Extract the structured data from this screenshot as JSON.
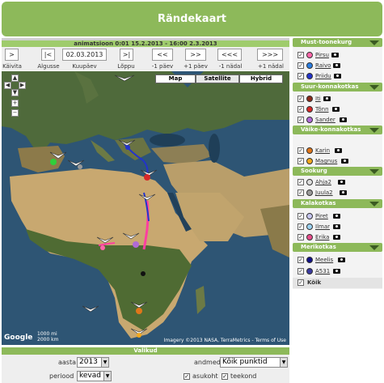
{
  "title": "Rändekaart",
  "animation": {
    "header": "animatsioon 0:01 15.2.2013 - 16:00 2.3.2013",
    "date_value": "02.03.2013",
    "buttons": [
      {
        "symbol": ">",
        "label": "Käivita"
      },
      {
        "symbol": "|<",
        "label": "Algusse"
      },
      {
        "symbol": ">|",
        "label": "Lõppu"
      },
      {
        "symbol": "<<",
        "label": "-1 päev"
      },
      {
        "symbol": ">>",
        "label": "+1 päev"
      },
      {
        "symbol": "<<<",
        "label": "-1 nädal"
      },
      {
        "symbol": ">>>",
        "label": "+1 nädal"
      }
    ],
    "date_label": "Kuupäev"
  },
  "map": {
    "types": [
      "Map",
      "Satellite",
      "Hybrid"
    ],
    "active_type": "Satellite",
    "copyright": "Imagery ©2013 NASA, TerraMetrics - Terms of Use",
    "logo": "Google",
    "scale": [
      "1000 mi",
      "2000 km"
    ]
  },
  "options": {
    "header": "Valikud",
    "year_label": "aasta",
    "year_value": "2013",
    "period_label": "periood",
    "period_value": "kevad",
    "data_label": "andmed",
    "data_value": "Kõik punktid",
    "location_label": "asukoht",
    "route_label": "teekond"
  },
  "groups": [
    {
      "name": "Must-toonekurg",
      "birds": [
        {
          "name": "Pirsu",
          "color": "#ff66aa",
          "checked": true
        },
        {
          "name": "Raivo",
          "color": "#2a7de1",
          "checked": true
        },
        {
          "name": "Priidu",
          "color": "#2233cc",
          "checked": true
        }
      ]
    },
    {
      "name": "Suur-konnakotkas",
      "birds": [
        {
          "name": "Iti",
          "color": "#8b2a1a",
          "checked": true
        },
        {
          "name": "Tõnn",
          "color": "#d62828",
          "checked": true
        },
        {
          "name": "Sander",
          "color": "#b06ad6",
          "checked": true
        }
      ]
    },
    {
      "name": "Väike-konnakotkas",
      "birds": [
        {
          "name": "Karin",
          "color": "#e0761a",
          "checked": true
        },
        {
          "name": "Magnus",
          "color": "#f2a81d",
          "checked": true
        }
      ]
    },
    {
      "name": "Sookurg",
      "birds": [
        {
          "name": "Ahja2",
          "color": "#dddddd",
          "checked": true
        },
        {
          "name": "Juula2",
          "color": "#9a9a9a",
          "checked": true
        }
      ]
    },
    {
      "name": "Kalakotkas",
      "birds": [
        {
          "name": "Piret",
          "color": "#c6c6f0",
          "checked": true
        },
        {
          "name": "Ilmar",
          "color": "#9bd1f0",
          "checked": true
        },
        {
          "name": "Erika",
          "color": "#e84c8c",
          "checked": true
        }
      ]
    },
    {
      "name": "Merikotkas",
      "birds": [
        {
          "name": "Meelis",
          "color": "#111188",
          "checked": true
        },
        {
          "name": "A531",
          "color": "#3a3aa0",
          "checked": true
        }
      ]
    }
  ],
  "all_label": "Kõik",
  "colors": {
    "accent": "#8db95a",
    "header_dark": "#3b5b22"
  }
}
